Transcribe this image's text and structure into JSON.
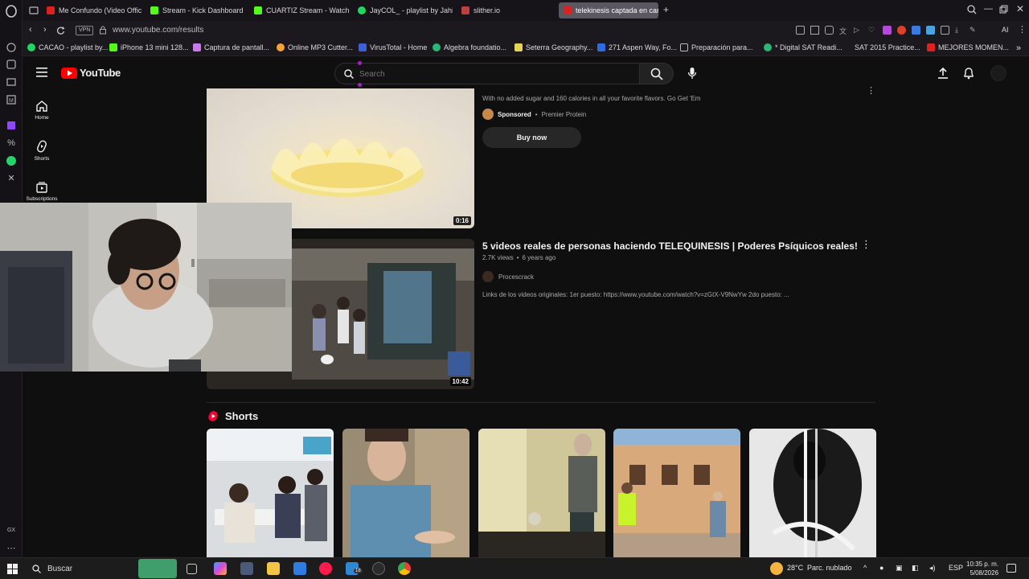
{
  "browser": {
    "tabs": [
      {
        "label": "Me Confundo (Video Offici...",
        "color": "#e02020"
      },
      {
        "label": "Stream - Kick Dashboard",
        "color": "#53fc18"
      },
      {
        "label": "CUARTIZ Stream - Watch L...",
        "color": "#53fc18"
      },
      {
        "label": "JayCOL_ - playlist by Jahid...",
        "color": "#1ed760"
      },
      {
        "label": "slither.io",
        "color": "#c04040"
      },
      {
        "label": "telekinesis captada en cam...",
        "color": "#e02020"
      }
    ],
    "url": "www.youtube.com/results",
    "vpn_label": "VPN",
    "bookmarks": [
      "CACAO - playlist by...",
      "iPhone 13 mini 128...",
      "Captura de pantall...",
      "Online MP3 Cutter...",
      "VirusTotal - Home",
      "Algebra foundatio...",
      "Seterra Geography...",
      "271 Aspen Way, Fo...",
      "Preparación para...",
      "* Digital SAT Readi...",
      "SAT 2015 Practice...",
      "MEJORES MOMEN..."
    ],
    "ai_label": "AI"
  },
  "youtube": {
    "logo_text": "YouTube",
    "search_placeholder": "Search",
    "sidebar": [
      {
        "label": "Home",
        "icon": "home-icon"
      },
      {
        "label": "Shorts",
        "icon": "shorts-icon"
      },
      {
        "label": "Subscriptions",
        "icon": "subscriptions-icon"
      }
    ],
    "ad": {
      "description": "With no added sugar and 160 calories in all your favorite flavors. Go Get 'Em",
      "sponsored": "Sponsored",
      "advertiser": "Premier Protein",
      "cta": "Buy now",
      "duration": "0:16"
    },
    "video": {
      "title": "5 videos reales de personas haciendo TELEQUINESIS | Poderes Psíquicos reales!",
      "views": "2.7K views",
      "age": "6 years ago",
      "channel": "Procescrack",
      "description": "Links de los videos originales: 1er puesto: https://www.youtube.com/watch?v=zGtX-V9NwYw 2do puesto: ...",
      "duration": "10:42"
    },
    "shorts_heading": "Shorts"
  },
  "taskbar": {
    "search_label": "Buscar",
    "weather_temp": "28°C",
    "weather_desc": "Parc. nublado",
    "language": "ESP",
    "time": "10:35 p. m.",
    "date": "5/08/2026",
    "mail_badge": "18"
  },
  "gx_label": "GX"
}
